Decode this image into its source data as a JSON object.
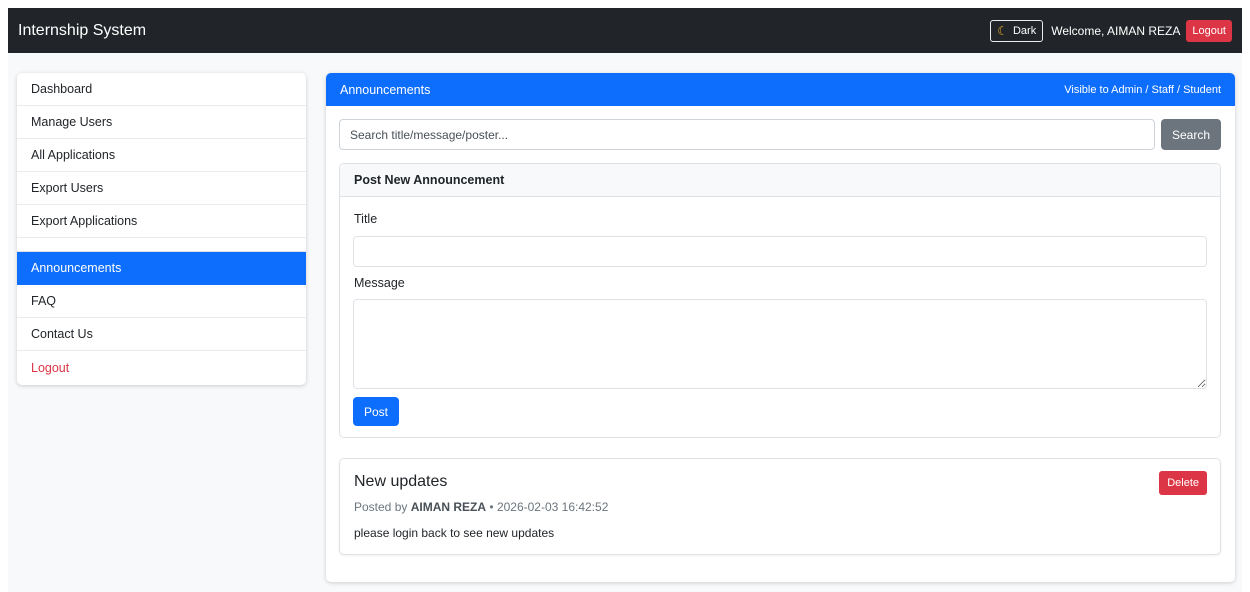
{
  "navbar": {
    "brand": "Internship System",
    "theme_toggle_label": "Dark",
    "welcome_text": "Welcome, AIMAN REZA",
    "logout_label": "Logout"
  },
  "sidebar": {
    "items": [
      {
        "label": "Dashboard"
      },
      {
        "label": "Manage Users"
      },
      {
        "label": "All Applications"
      },
      {
        "label": "Export Users"
      },
      {
        "label": "Export Applications"
      },
      {
        "label": "Announcements",
        "active": true
      },
      {
        "label": "FAQ"
      },
      {
        "label": "Contact Us"
      },
      {
        "label": "Logout"
      }
    ]
  },
  "main": {
    "header_title": "Announcements",
    "header_visibility": "Visible to Admin / Staff / Student",
    "search": {
      "placeholder": "Search title/message/poster...",
      "value": "",
      "button_label": "Search"
    },
    "post_form": {
      "header": "Post New Announcement",
      "title_label": "Title",
      "title_value": "",
      "message_label": "Message",
      "message_value": "",
      "submit_label": "Post"
    },
    "announcements": [
      {
        "title": "New updates",
        "posted_by_prefix": "Posted by",
        "poster": "AIMAN REZA",
        "separator": "•",
        "timestamp": "2026-02-03 16:42:52",
        "message": "please login back to see new updates",
        "delete_label": "Delete"
      }
    ]
  },
  "colors": {
    "navbar_bg": "#212529",
    "primary": "#0d6efd",
    "danger": "#dc3545",
    "secondary": "#6c757d"
  }
}
